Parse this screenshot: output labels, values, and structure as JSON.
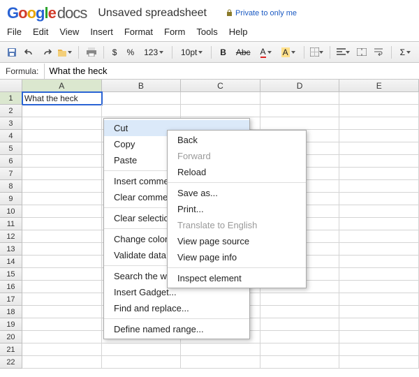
{
  "brand": {
    "docs": "docs"
  },
  "title": "Unsaved spreadsheet",
  "privacy": {
    "label": "Private to only me"
  },
  "menu": [
    "File",
    "Edit",
    "View",
    "Insert",
    "Format",
    "Form",
    "Tools",
    "Help"
  ],
  "toolbar": {
    "currency": "$",
    "percent": "%",
    "more": "123",
    "font": "10pt",
    "bold": "B",
    "strike": "Abc",
    "underlineA": "A",
    "fillA": "A",
    "sigma": "Σ"
  },
  "formula": {
    "label": "Formula:",
    "value": "What the heck"
  },
  "columns": [
    "A",
    "B",
    "C",
    "D",
    "E"
  ],
  "cellA1": "What the heck",
  "appMenu": {
    "cut": "Cut",
    "copy": "Copy",
    "paste": "Paste",
    "insertComment": "Insert comment",
    "clearComment": "Clear comments",
    "clearSelection": "Clear selection",
    "changeColors": "Change colors",
    "validateData": "Validate data",
    "searchWeb": "Search the web",
    "insertGadget": "Insert Gadget...",
    "findReplace": "Find and replace...",
    "defineRange": "Define named range..."
  },
  "browserMenu": {
    "back": "Back",
    "forward": "Forward",
    "reload": "Reload",
    "saveAs": "Save as...",
    "print": "Print...",
    "translate": "Translate to English",
    "viewSource": "View page source",
    "viewInfo": "View page info",
    "inspect": "Inspect element"
  }
}
